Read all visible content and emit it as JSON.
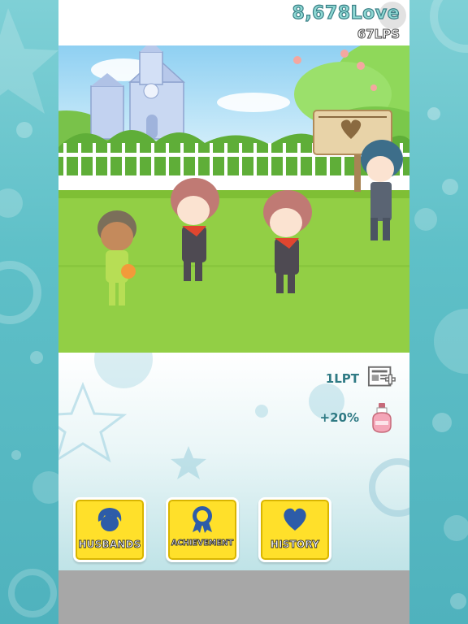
{
  "hud": {
    "love_count": "8,678Love",
    "lps": "67LPS",
    "gear_icon": "gear-icon"
  },
  "stats": [
    {
      "label": "1LPT",
      "icon": "newspaper-plus-icon"
    },
    {
      "label": "+20%",
      "icon": "potion-bottle-icon"
    }
  ],
  "menu": [
    {
      "label": "HUSBANDS",
      "icon": "husband-head-icon"
    },
    {
      "label": "ACHIEVEMENT",
      "icon": "ribbon-medal-icon"
    },
    {
      "label": "HISTORY",
      "icon": "heart-icon"
    }
  ],
  "colors": {
    "side_background": "#5fc0c8",
    "button_yellow": "#ffe02a",
    "stat_text": "#2f7a84",
    "bottom_bar": "#a7a7a7",
    "grass": "#92cf45"
  }
}
